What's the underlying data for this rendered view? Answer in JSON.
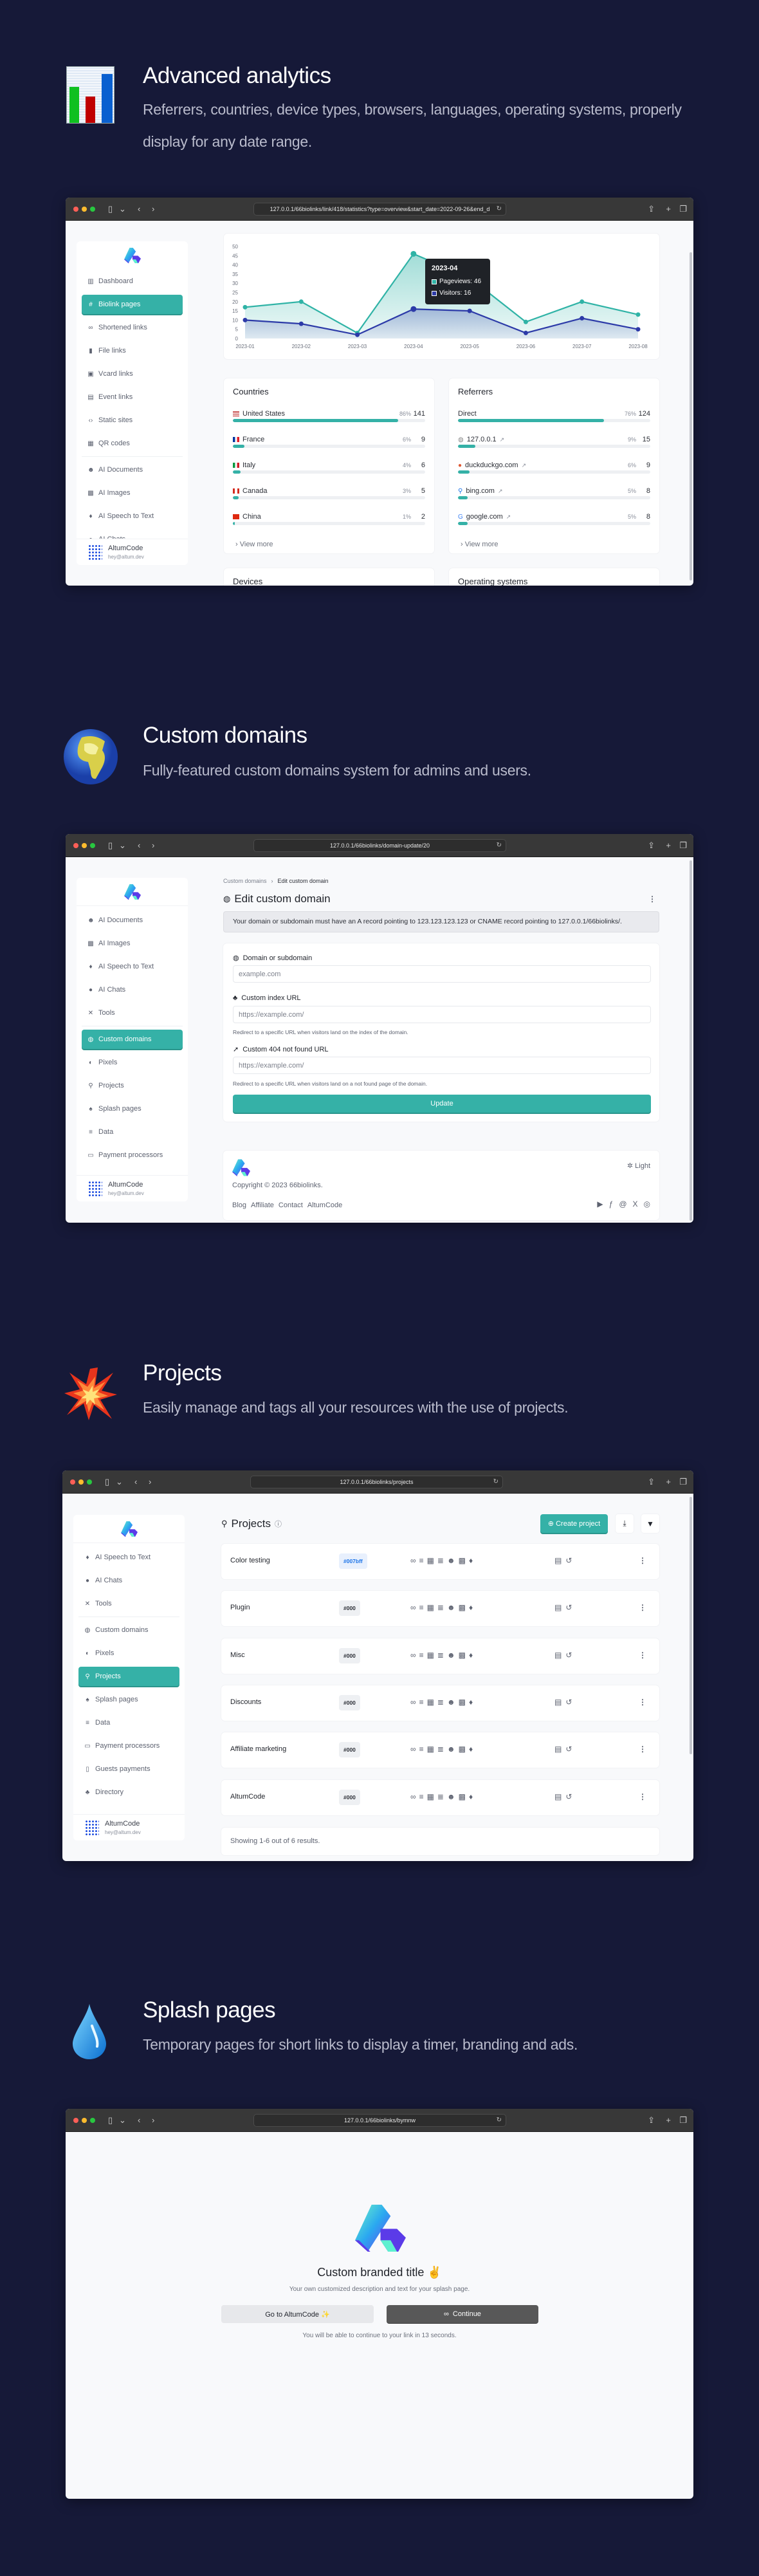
{
  "page": {
    "background": "#161938",
    "accent": "#35b1a7"
  },
  "sections": [
    {
      "icon": "bar-chart-icon",
      "title": "Advanced analytics",
      "subtitle": "Referrers, countries, device types, browsers, languages, operating systems, properly display for any date range."
    },
    {
      "icon": "globe-icon",
      "title": "Custom domains",
      "subtitle": "Fully-featured custom domains system for admins and users."
    },
    {
      "icon": "collision-icon",
      "title": "Projects",
      "subtitle": "Easily manage and tags all your resources with the use of projects."
    },
    {
      "icon": "droplet-icon",
      "title": "Splash pages",
      "subtitle": "Temporary pages for short links to display a timer, branding and ads."
    }
  ],
  "user": {
    "name": "AltumCode",
    "email": "hey@altum.dev"
  },
  "analytics": {
    "url": "127.0.0.1/66biolinks/link/418/statistics?type=overview&start_date=2022-09-26&end_d",
    "sidebar": [
      {
        "label": "Dashboard",
        "icon": "dashboard-icon"
      },
      {
        "label": "Biolink pages",
        "icon": "hash-icon",
        "active": true
      },
      {
        "label": "Shortened links",
        "icon": "link-icon"
      },
      {
        "label": "File links",
        "icon": "file-icon"
      },
      {
        "label": "Vcard links",
        "icon": "id-card-icon"
      },
      {
        "label": "Event links",
        "icon": "calendar-icon"
      },
      {
        "label": "Static sites",
        "icon": "code-icon"
      },
      {
        "label": "QR codes",
        "icon": "qr-icon"
      },
      {
        "divider": true
      },
      {
        "label": "AI Documents",
        "icon": "robot-icon"
      },
      {
        "label": "AI Images",
        "icon": "image-icon"
      },
      {
        "label": "AI Speech to Text",
        "icon": "mic-icon"
      },
      {
        "label": "AI Chats",
        "icon": "chat-icon"
      }
    ],
    "tooltip": {
      "title": "2023-04",
      "pageviews": "Pageviews: 46",
      "visitors": "Visitors: 16"
    },
    "countries": {
      "title": "Countries",
      "rows": [
        {
          "label": "United States",
          "flag": "flag-us",
          "pct": "86%",
          "value": "141",
          "fill": 86
        },
        {
          "label": "France",
          "flag": "flag-fr",
          "pct": "6%",
          "value": "9",
          "fill": 6
        },
        {
          "label": "Italy",
          "flag": "flag-it",
          "pct": "4%",
          "value": "6",
          "fill": 4
        },
        {
          "label": "Canada",
          "flag": "flag-ca",
          "pct": "3%",
          "value": "5",
          "fill": 3
        },
        {
          "label": "China",
          "flag": "flag-cn",
          "pct": "1%",
          "value": "2",
          "fill": 1
        }
      ],
      "view_more": "View more"
    },
    "referrers": {
      "title": "Referrers",
      "rows": [
        {
          "label": "Direct",
          "pct": "76%",
          "value": "124",
          "fill": 76
        },
        {
          "label": "127.0.0.1",
          "icon": "globe-icon",
          "external": true,
          "pct": "9%",
          "value": "15",
          "fill": 9
        },
        {
          "label": "duckduckgo.com",
          "icon": "duckduckgo-icon",
          "external": true,
          "pct": "6%",
          "value": "9",
          "fill": 6
        },
        {
          "label": "bing.com",
          "icon": "bing-icon",
          "external": true,
          "pct": "5%",
          "value": "8",
          "fill": 5
        },
        {
          "label": "google.com",
          "icon": "google-icon",
          "external": true,
          "pct": "5%",
          "value": "8",
          "fill": 5
        }
      ],
      "view_more": "View more"
    },
    "devices_title": "Devices",
    "os_title": "Operating systems"
  },
  "chart_data": {
    "type": "line",
    "categories": [
      "2023-01",
      "2023-02",
      "2023-03",
      "2023-04",
      "2023-05",
      "2023-06",
      "2023-07",
      "2023-08"
    ],
    "series": [
      {
        "name": "Pageviews",
        "color": "#2fb3a6",
        "values": [
          17,
          20,
          3,
          46,
          33,
          9,
          20,
          13
        ]
      },
      {
        "name": "Visitors",
        "color": "#2c3aa8",
        "values": [
          10,
          8,
          2,
          16,
          15,
          3,
          11,
          5
        ]
      }
    ],
    "ylim": [
      0,
      50
    ],
    "yticks": [
      0,
      5,
      10,
      15,
      20,
      25,
      30,
      35,
      40,
      45,
      50
    ],
    "grid": false,
    "area": true
  },
  "domains": {
    "url": "127.0.0.1/66biolinks/domain-update/20",
    "sidebar": [
      {
        "label": "AI Documents",
        "icon": "robot-icon"
      },
      {
        "label": "AI Images",
        "icon": "image-icon"
      },
      {
        "label": "AI Speech to Text",
        "icon": "mic-icon"
      },
      {
        "label": "AI Chats",
        "icon": "chat-icon"
      },
      {
        "label": "Tools",
        "icon": "tools-icon"
      },
      {
        "divider": true
      },
      {
        "label": "Custom domains",
        "icon": "globe-icon",
        "active": true
      },
      {
        "label": "Pixels",
        "icon": "pixel-icon"
      },
      {
        "label": "Projects",
        "icon": "project-icon"
      },
      {
        "label": "Splash pages",
        "icon": "droplet-icon"
      },
      {
        "label": "Data",
        "icon": "database-icon"
      },
      {
        "label": "Payment processors",
        "icon": "credit-card-icon"
      }
    ],
    "breadcrumb": [
      "Custom domains",
      "Edit custom domain"
    ],
    "title": "Edit custom domain",
    "alert": "Your domain or subdomain must have an A record pointing to 123.123.123.123 or CNAME record pointing to 127.0.0.1/66biolinks/.",
    "fields": [
      {
        "label": "Domain or subdomain",
        "icon": "globe-icon",
        "placeholder": "example.com",
        "help": ""
      },
      {
        "label": "Custom index URL",
        "icon": "sitemap-icon",
        "placeholder": "https://example.com/",
        "help": "Redirect to a specific URL when visitors land on the index of the domain."
      },
      {
        "label": "Custom 404 not found URL",
        "icon": "location-arrow-icon",
        "placeholder": "https://example.com/",
        "help": "Redirect to a specific URL when visitors land on a not found page of the domain."
      }
    ],
    "submit": "Update",
    "footer": {
      "theme": "Light",
      "copyright": "Copyright © 2023 66biolinks.",
      "links": [
        "Blog",
        "Affiliate",
        "Contact",
        "AltumCode"
      ],
      "social": [
        "youtube-icon",
        "facebook-icon",
        "threads-icon",
        "x-icon",
        "instagram-icon"
      ]
    }
  },
  "projects": {
    "url": "127.0.0.1/66biolinks/projects",
    "sidebar": [
      {
        "label": "AI Speech to Text",
        "icon": "mic-icon"
      },
      {
        "label": "AI Chats",
        "icon": "chat-icon"
      },
      {
        "label": "Tools",
        "icon": "tools-icon"
      },
      {
        "divider": true
      },
      {
        "label": "Custom domains",
        "icon": "globe-icon"
      },
      {
        "label": "Pixels",
        "icon": "pixel-icon"
      },
      {
        "label": "Projects",
        "icon": "project-icon",
        "active": true
      },
      {
        "label": "Splash pages",
        "icon": "droplet-icon"
      },
      {
        "label": "Data",
        "icon": "database-icon"
      },
      {
        "label": "Payment processors",
        "icon": "credit-card-icon"
      },
      {
        "label": "Guests payments",
        "icon": "wallet-icon"
      },
      {
        "label": "Directory",
        "icon": "sitemap-icon"
      }
    ],
    "title": "Projects",
    "create_label": "Create project",
    "rows": [
      {
        "name": "Color testing",
        "color": "#007bff"
      },
      {
        "name": "Plugin",
        "color": "#000"
      },
      {
        "name": "Misc",
        "color": "#000"
      },
      {
        "name": "Discounts",
        "color": "#000"
      },
      {
        "name": "Affiliate marketing",
        "color": "#000"
      },
      {
        "name": "AltumCode",
        "color": "#000"
      }
    ],
    "row_icons": [
      "link-icon",
      "database-icon",
      "qr-icon",
      "layers-icon",
      "robot-icon",
      "image-icon",
      "mic-icon"
    ],
    "row_icons2": [
      "calendar-icon",
      "history-icon"
    ],
    "pagination": "Showing 1-6 out of 6 results."
  },
  "splash": {
    "url": "127.0.0.1/66biolinks/bymnw",
    "title": "Custom branded title ✌️",
    "description": "Your own customized description and text for your splash page.",
    "secondary_button": "Go to AltumCode ✨",
    "primary_button": "Continue",
    "timer_text": "You will be able to continue to your link in 13 seconds."
  }
}
